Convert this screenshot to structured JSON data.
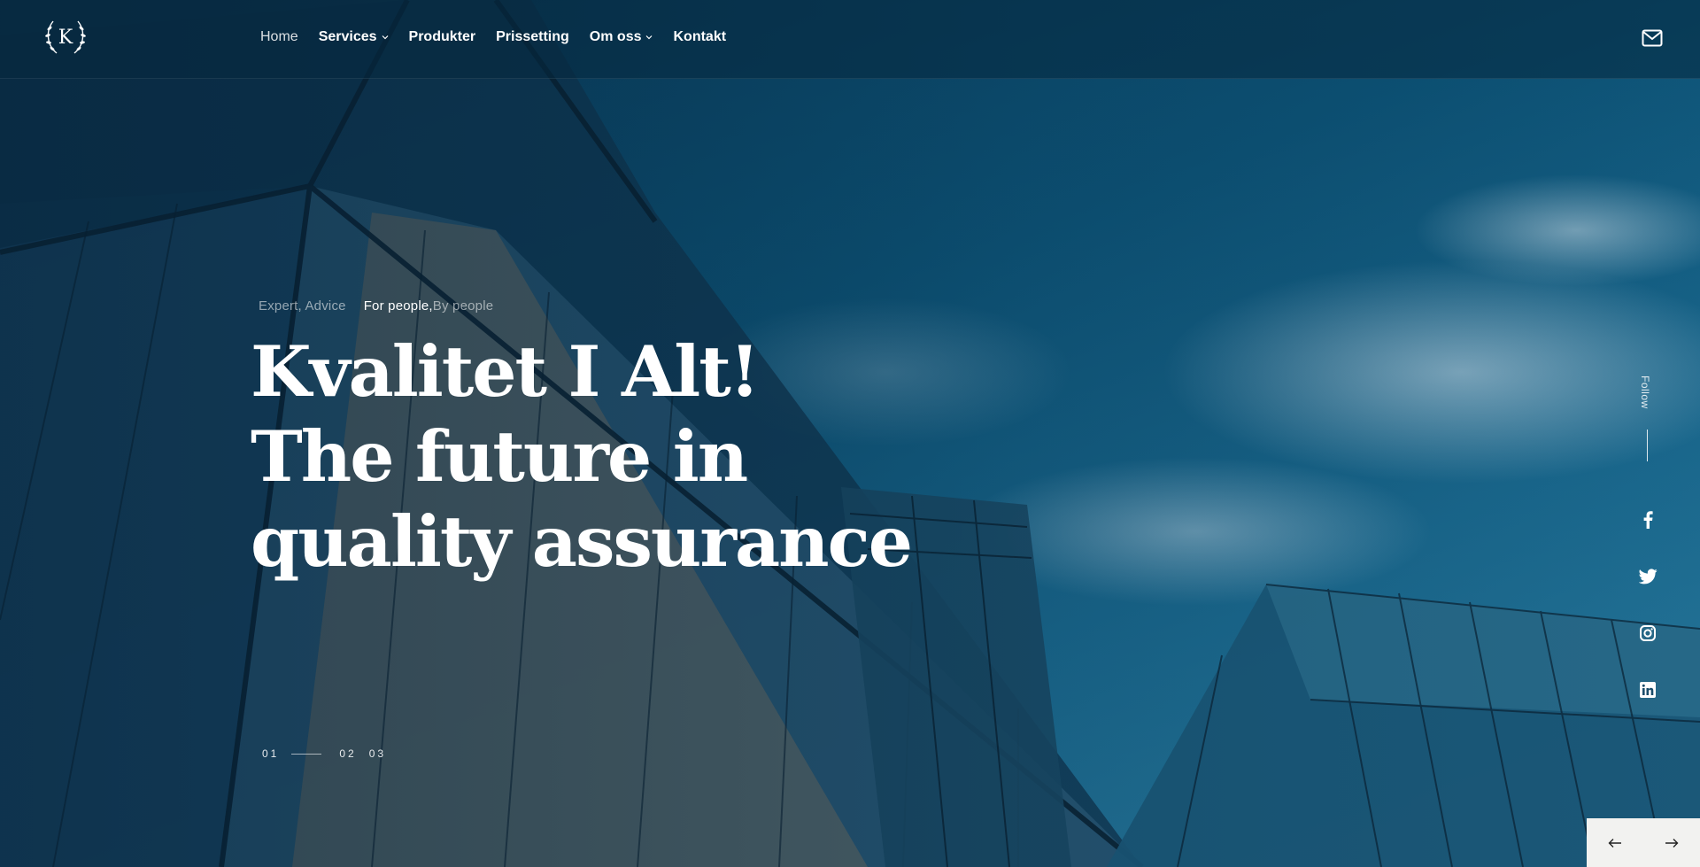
{
  "nav": {
    "home": "Home",
    "services": "Services",
    "produkter": "Produkter",
    "prissetting": "Prissetting",
    "om_oss": "Om oss",
    "kontakt": "Kontakt"
  },
  "logo": {
    "letter": "K"
  },
  "hero": {
    "tagline_1": "Expert, Advice",
    "tagline_2a": "For people,",
    "tagline_2b": " By people",
    "headline_line_1": "Kvalitet I Alt!",
    "headline_line_2": "The future in",
    "headline_line_3": "quality assurance"
  },
  "pager": {
    "slide_1": "01",
    "slide_2": "02",
    "slide_3": "03",
    "active_slide": 1
  },
  "social": {
    "follow_label": "Follow",
    "icons": [
      "facebook-icon",
      "twitter-icon",
      "instagram-icon",
      "linkedin-icon"
    ]
  },
  "icons": {
    "mail": "mail-icon",
    "prev": "arrow-left-icon",
    "next": "arrow-right-icon"
  },
  "colors": {
    "arrow_panel": "#f2f2f0",
    "text": "#ffffff"
  }
}
